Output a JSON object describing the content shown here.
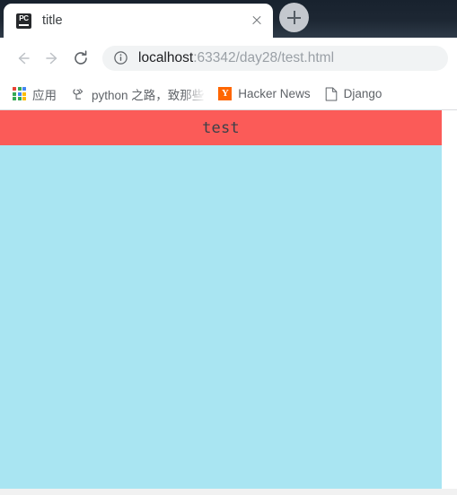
{
  "browser": {
    "tab": {
      "title": "title",
      "favicon_name": "pycharm-favicon",
      "favicon_text": "PC",
      "close_label": "×"
    },
    "new_tab_label": "+",
    "toolbar": {
      "back_label": "Back",
      "forward_label": "Forward",
      "reload_label": "Reload",
      "omnibox": {
        "info_label": "Site information",
        "host": "localhost",
        "path": ":63342/day28/test.html",
        "full_url": "localhost:63342/day28/test.html"
      }
    },
    "bookmarks": [
      {
        "label": "应用",
        "icon": "apps-grid-icon",
        "truncated": false
      },
      {
        "label": "python 之路，致那些",
        "icon": "python-road-icon",
        "truncated": true
      },
      {
        "label": "Hacker News",
        "icon": "hacker-news-icon",
        "icon_text": "Y",
        "truncated": false
      },
      {
        "label": "Django",
        "icon": "document-icon",
        "truncated": false
      }
    ]
  },
  "page": {
    "banner_text": "test",
    "banner_color": "#fb5b58",
    "body_color": "#a9e5f2",
    "banner_text_color": "#3b4149"
  },
  "colors": {
    "tabstrip_dark": "#1d2733",
    "apps_grid": [
      "#ea4335",
      "#34a853",
      "#4285f4",
      "#34a853",
      "#4285f4",
      "#fbbc05",
      "#34a853",
      "#34a853",
      "#fbbc05"
    ],
    "hacker_news_orange": "#ff6600",
    "omnibox_bg": "#f1f3f4",
    "url_host_color": "#202124",
    "url_path_color": "#9aa0a6"
  }
}
